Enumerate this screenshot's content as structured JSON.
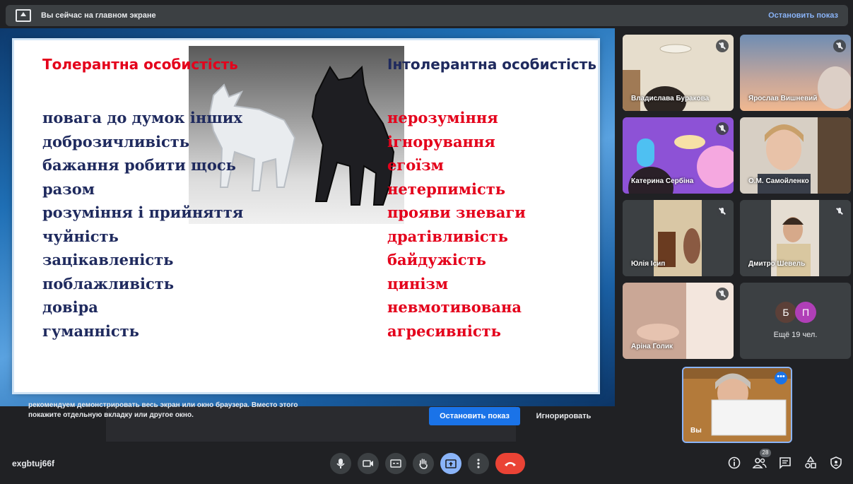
{
  "topbar": {
    "icon": "present-screen-icon",
    "message": "Вы сейчас на главном экране",
    "stop_label": "Остановить показ"
  },
  "slide": {
    "left_heading": "Толерантна особистість",
    "right_heading": "Інтолерантна особистість",
    "left_items": [
      "повага до думок інших",
      "доброзичливість",
      "бажання робити щось",
      "разом",
      "розуміння і прийняття",
      "чуйність",
      "зацікавленість",
      "поблажливість",
      "довіра",
      "гуманність"
    ],
    "right_items": [
      "нерозуміння",
      "ігнорування",
      "егоїзм",
      "нетерпимість",
      "прояви зневаги",
      "дратівливість",
      "байдужість",
      "цинізм",
      "невмотивована",
      "агресивність"
    ],
    "colors": {
      "positive_text": "#1f2a5e",
      "negative_text": "#e4001b"
    }
  },
  "notice": {
    "text": "рекомендуем демонстрировать весь экран или окно браузера. Вместо этого покажите отдельную вкладку или другое окно.",
    "stop_button": "Остановить показ",
    "ignore_button": "Игнорировать"
  },
  "participants": [
    {
      "name": "Владислава Буракова",
      "muted": true
    },
    {
      "name": "Ярослав Вишневий",
      "muted": true
    },
    {
      "name": "Катерина Сербіна",
      "muted": true
    },
    {
      "name": "О.М. Самойленко",
      "muted": false
    },
    {
      "name": "Юлія Ісип",
      "muted": true
    },
    {
      "name": "Дмитро Шевель",
      "muted": true
    },
    {
      "name": "Аріна Голик",
      "muted": true
    }
  ],
  "others": {
    "avatars": [
      "Б",
      "П"
    ],
    "label": "Ещё 19 чел."
  },
  "self": {
    "name": "Вы"
  },
  "bottom": {
    "meeting_code": "exgbtuj66f",
    "participant_count": "28"
  }
}
